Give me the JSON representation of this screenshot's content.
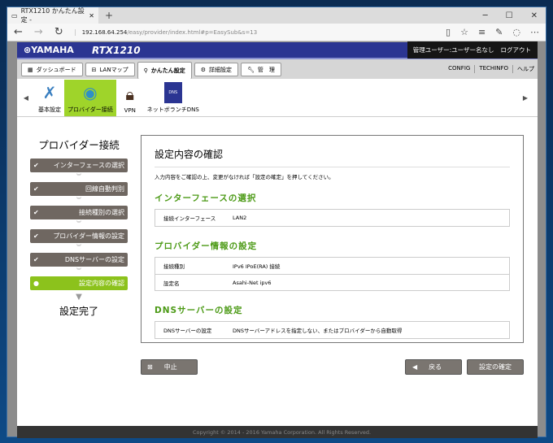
{
  "browser": {
    "tab_title": "RTX1210 かんたん設定 - ",
    "url_host": "192.168.64.254",
    "url_path": "/easy/provider/index.html#p=EasySub&s=13"
  },
  "header": {
    "logo": "⊛YAMAHA",
    "model": "RTX1210",
    "user": "管理ユーザー:ユーザー名なし",
    "logout": "ログアウト"
  },
  "nav": {
    "tabs": [
      "ダッシュボード",
      "LANマップ",
      "かんたん設定",
      "詳細設定",
      "管　理"
    ],
    "links": [
      "CONFIG",
      "TECHINFO",
      "ヘルプ"
    ]
  },
  "icons": [
    "基本設定",
    "プロバイダー接続",
    "VPN",
    "ネットボランチDNS"
  ],
  "sidebar": {
    "title": "プロバイダー接続",
    "steps": [
      "インターフェースの選択",
      "回線自動判別",
      "接続種別の選択",
      "プロバイダー情報の設定",
      "DNSサーバーの設定",
      "設定内容の確認"
    ],
    "done": "設定完了"
  },
  "main": {
    "title": "設定内容の確認",
    "lead": "入力内容をご確認の上、変更がなければ「設定の確定」を押してください。",
    "sections": [
      {
        "title": "インターフェースの選択",
        "rows": [
          [
            "接続インターフェース",
            "LAN2"
          ]
        ]
      },
      {
        "title": "プロバイダー情報の設定",
        "rows": [
          [
            "接続種別",
            "IPv6 IPoE(RA) 接続"
          ],
          [
            "設定名",
            "Asahi-Net ipv6"
          ]
        ]
      },
      {
        "title": "DNSサーバーの設定",
        "rows": [
          [
            "DNSサーバーの設定",
            "DNSサーバーアドレスを指定しない、またはプロバイダーから自動取得"
          ]
        ]
      }
    ]
  },
  "buttons": {
    "cancel": "中止",
    "back": "戻る",
    "confirm": "設定の確定"
  },
  "footer": "Copyright © 2014 - 2016 Yamaha Corporation. All Rights Reserved."
}
